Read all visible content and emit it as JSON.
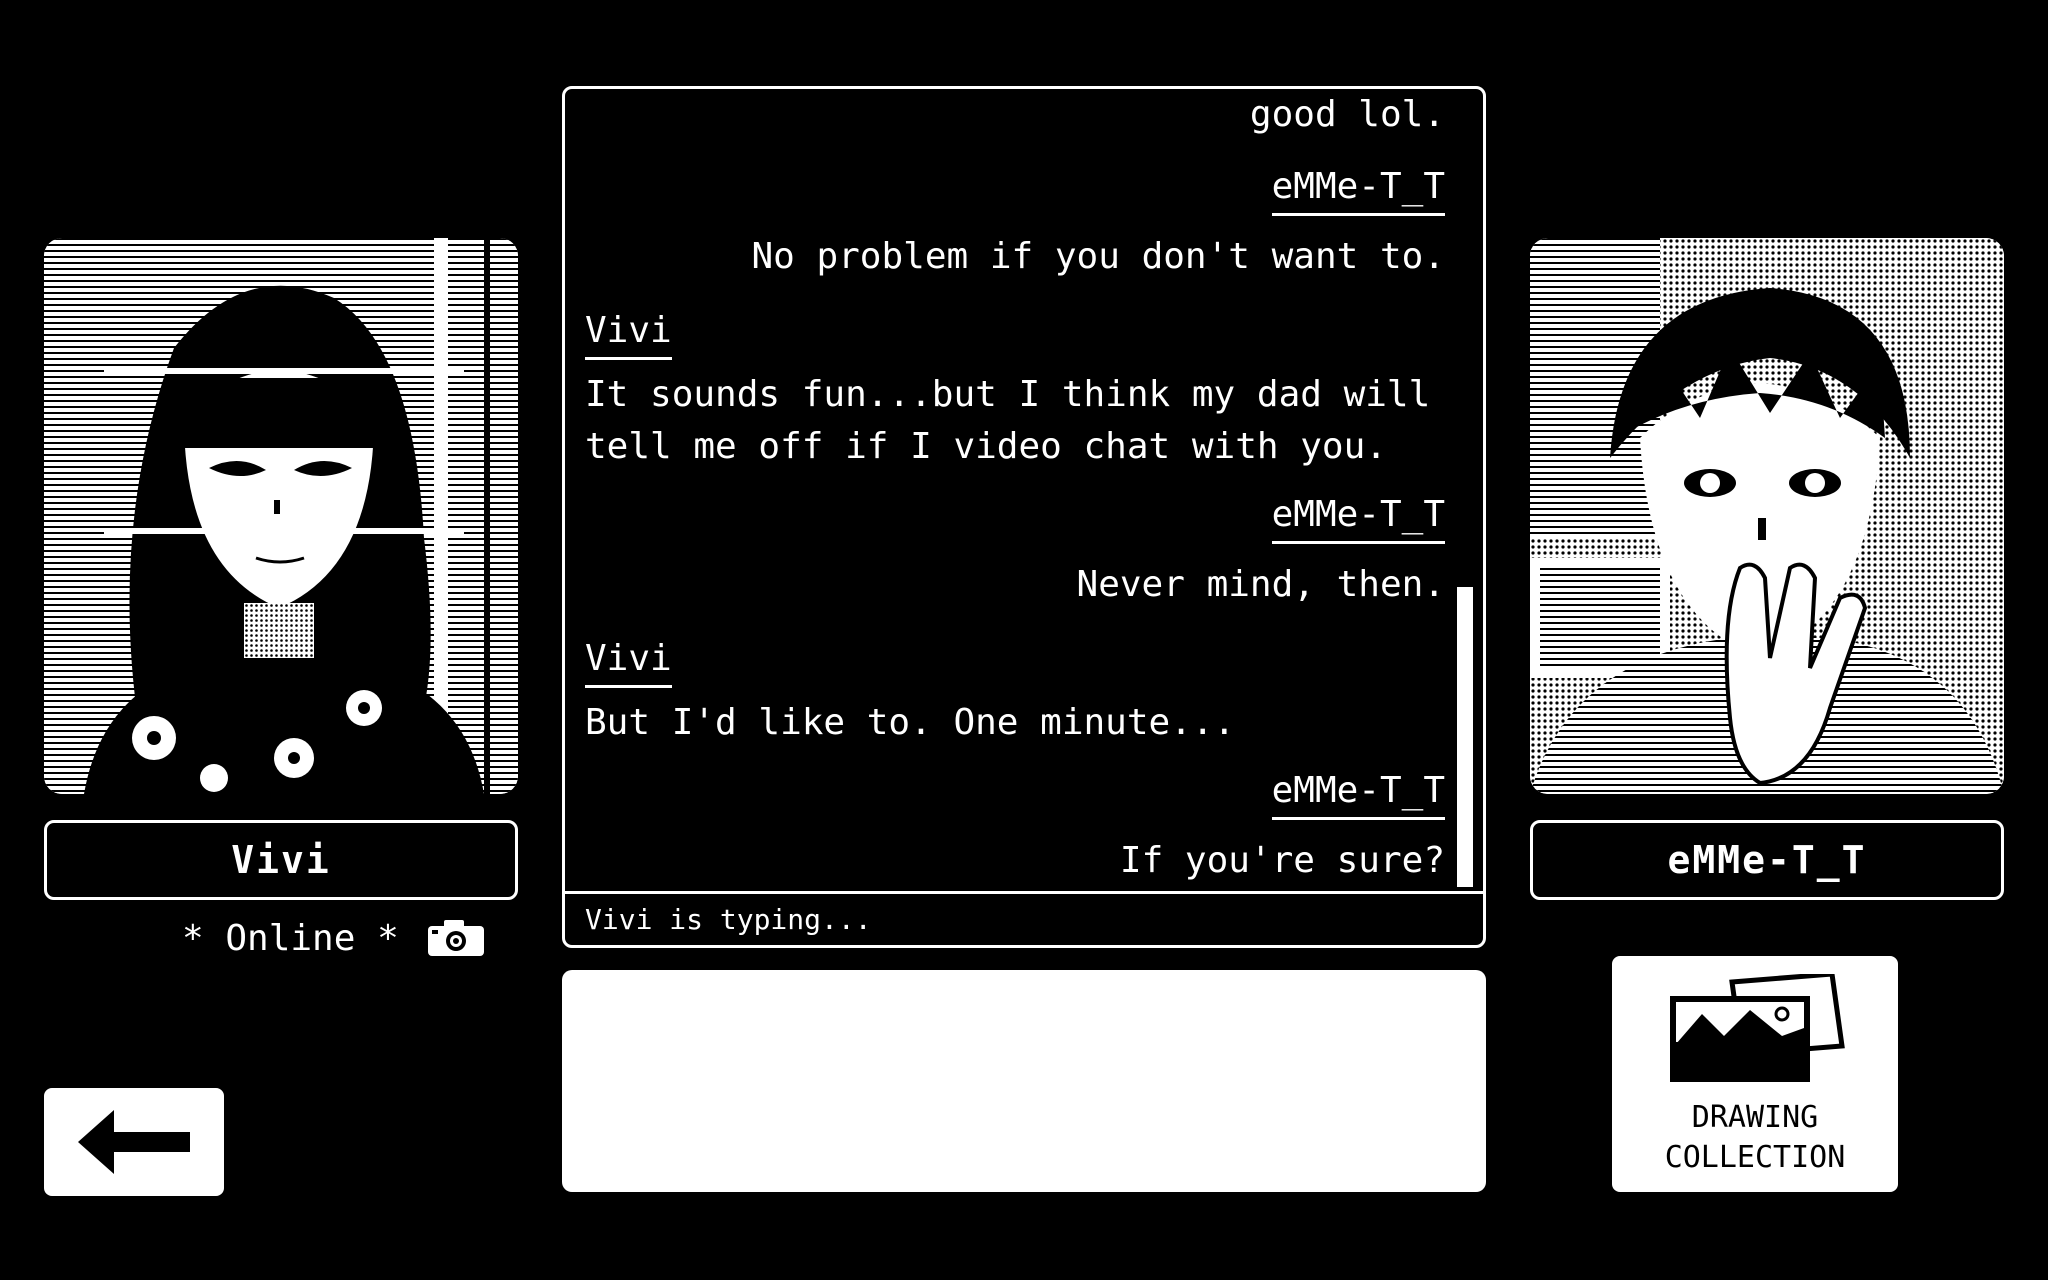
{
  "left_contact": {
    "name": "Vivi",
    "status": "* Online *"
  },
  "right_contact": {
    "name": "eMMe-T_T"
  },
  "chat": {
    "messages": [
      {
        "side": "right",
        "text": "good lol."
      },
      {
        "side": "right",
        "sender": "eMMe-T_T",
        "text": "No problem if you don't want to."
      },
      {
        "side": "left",
        "sender": "Vivi",
        "text_line1": "It sounds fun...but I think my dad will",
        "text_line2": "tell me off if I video chat with you."
      },
      {
        "side": "right",
        "sender": "eMMe-T_T",
        "text": "Never mind, then."
      },
      {
        "side": "left",
        "sender": "Vivi",
        "text": "But I'd like to. One minute..."
      },
      {
        "side": "right",
        "sender": "eMMe-T_T",
        "text": "If you're sure?"
      }
    ],
    "typing_status": "Vivi is typing..."
  },
  "drawing_collection": {
    "label_line1": "DRAWING",
    "label_line2": "COLLECTION"
  },
  "icons": {
    "back": "left-arrow-icon",
    "camera": "camera-icon",
    "gallery": "picture-gallery-icon"
  },
  "colors": {
    "background": "#000000",
    "foreground": "#ffffff"
  }
}
